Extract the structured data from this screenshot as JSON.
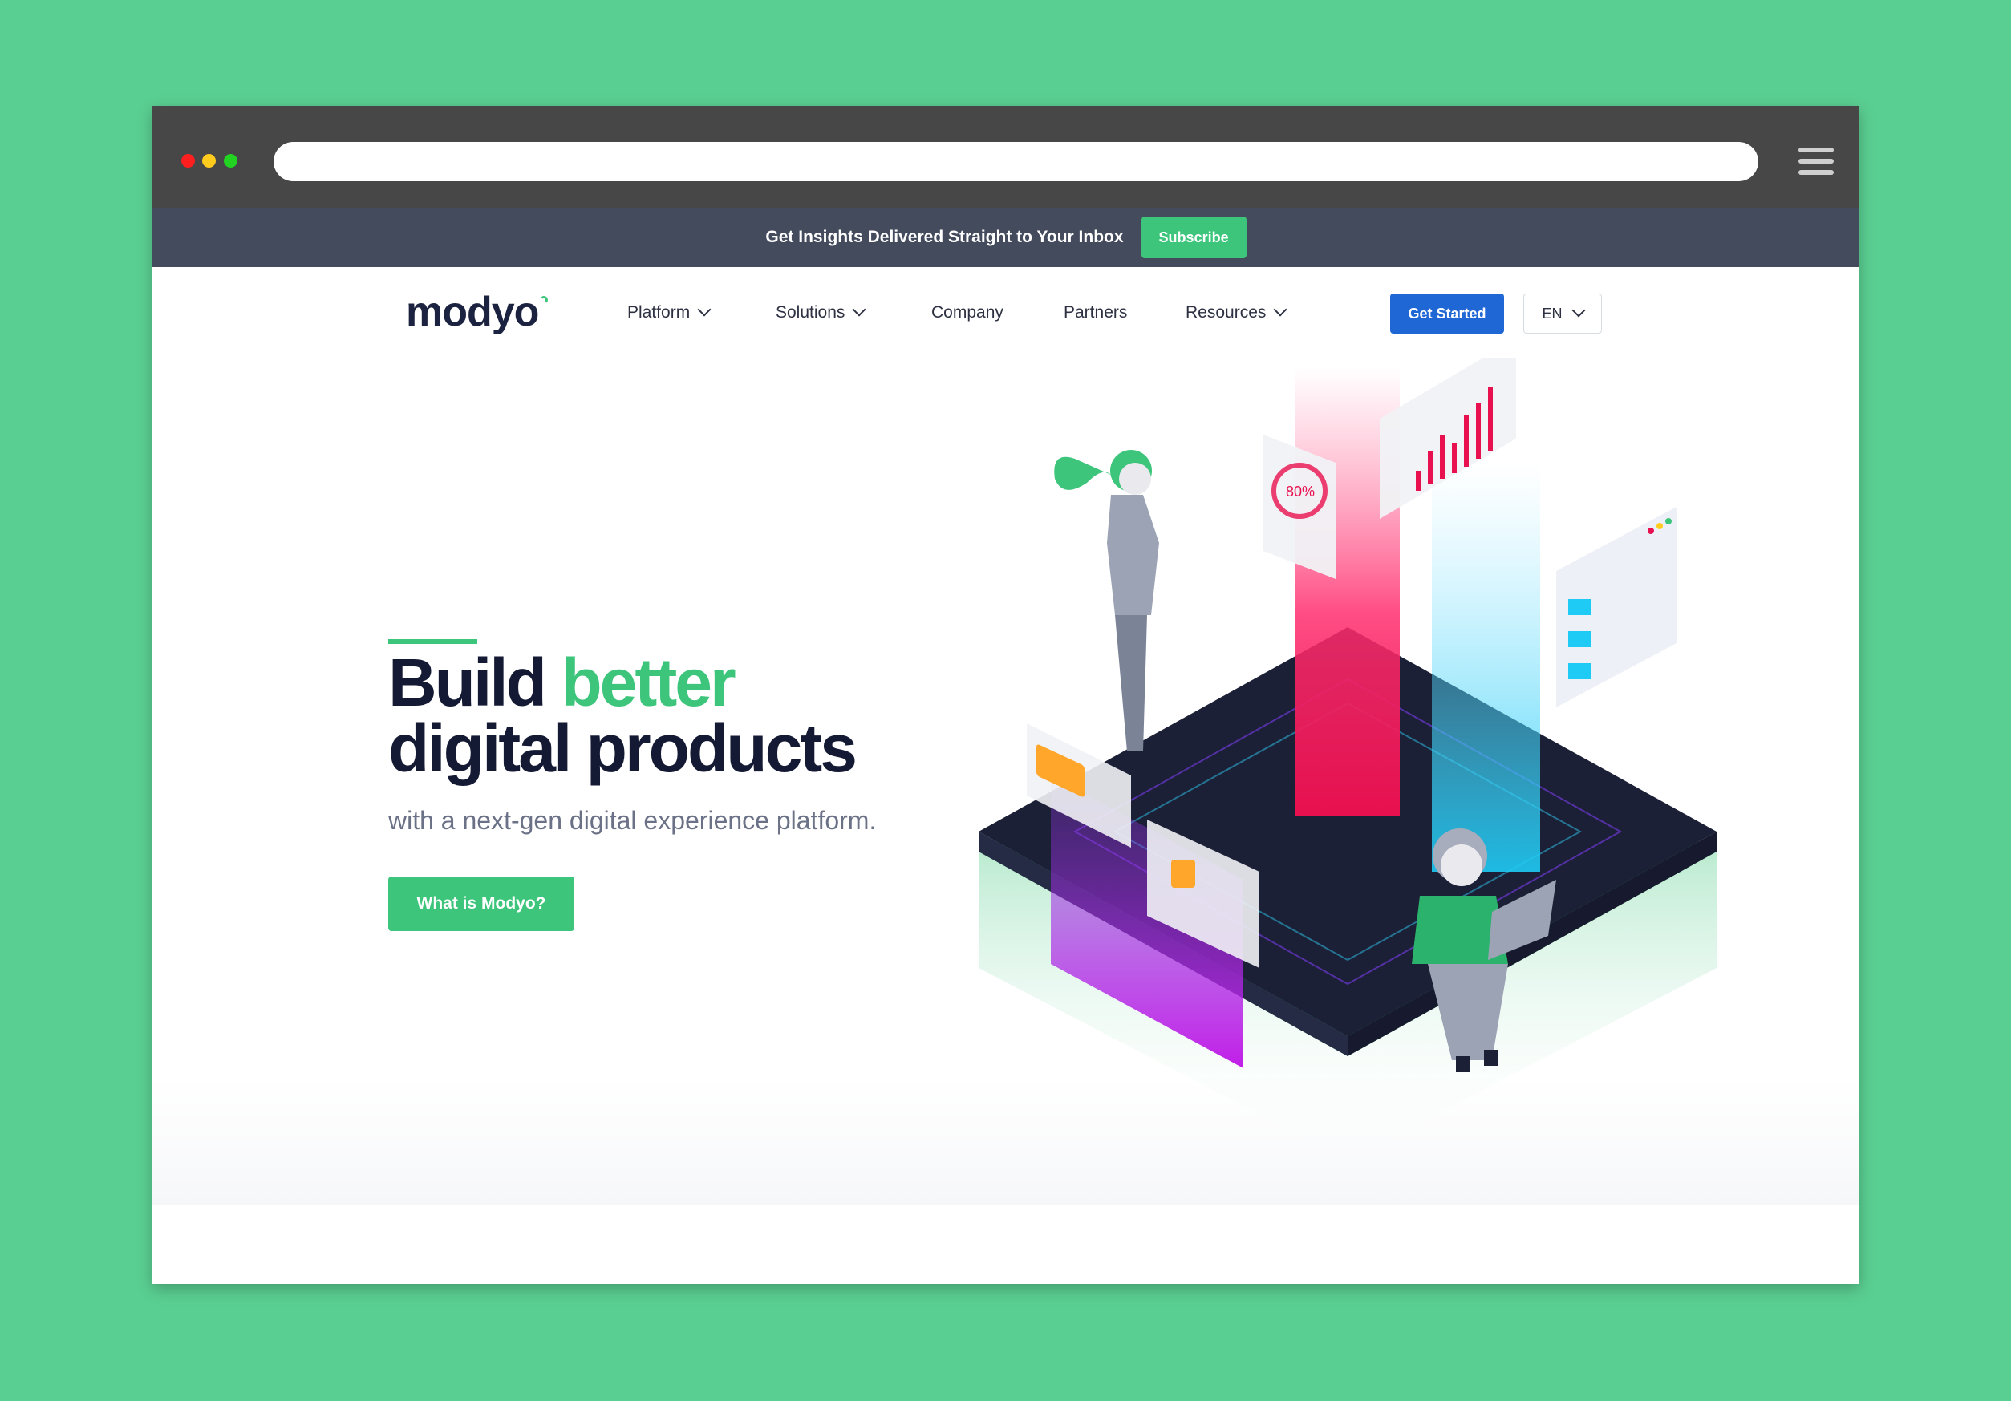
{
  "promo": {
    "text": "Get Insights Delivered Straight to Your Inbox",
    "button": "Subscribe"
  },
  "nav": {
    "logo": "modyo",
    "items": [
      {
        "label": "Platform",
        "dropdown": true
      },
      {
        "label": "Solutions",
        "dropdown": true
      },
      {
        "label": "Company",
        "dropdown": false
      },
      {
        "label": "Partners",
        "dropdown": false
      },
      {
        "label": "Resources",
        "dropdown": true
      }
    ],
    "cta": "Get Started",
    "language": "EN"
  },
  "hero": {
    "headline_word1": "Build",
    "headline_accent": "better",
    "headline_line2": "digital products",
    "subhead": "with a next-gen digital experience platform.",
    "cta": "What is Modyo?",
    "illustration_gauge": "80%"
  },
  "colors": {
    "page_background": "#5acf92",
    "brand_green": "#3ec57c",
    "brand_blue": "#1f67d4",
    "navy": "#151a34",
    "promo_bar": "#434b5d",
    "browser_chrome": "#474747"
  }
}
